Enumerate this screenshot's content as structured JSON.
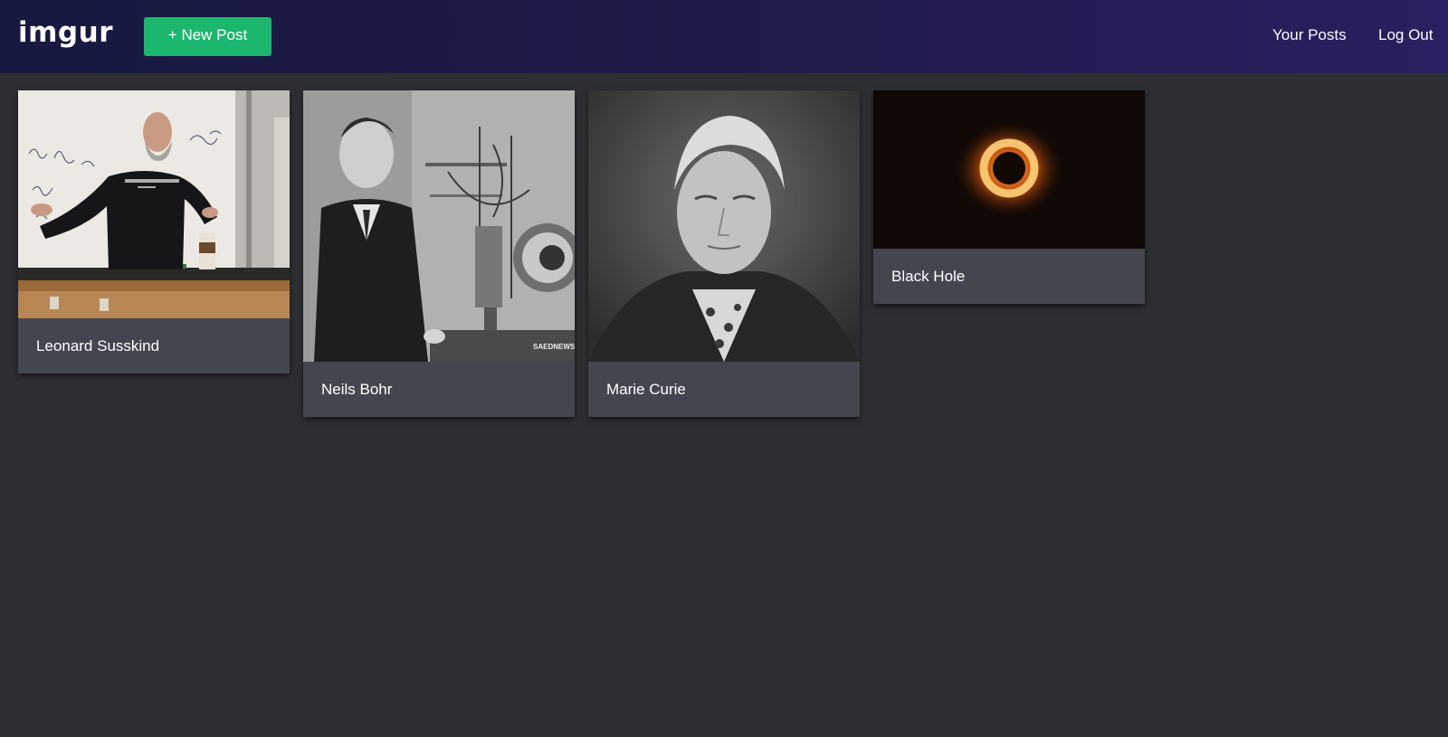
{
  "header": {
    "logo": "imgur",
    "new_post_label": "+ New Post",
    "nav": {
      "your_posts": "Your Posts",
      "log_out": "Log Out"
    }
  },
  "posts": [
    {
      "title": "Leonard Susskind"
    },
    {
      "title": "Neils Bohr",
      "image_watermark": "SAEDNEWS"
    },
    {
      "title": "Marie Curie"
    },
    {
      "title": "Black Hole"
    }
  ],
  "colors": {
    "header_gradient_start": "#171940",
    "header_gradient_end": "#2a1f60",
    "new_post_button": "#1bb76e",
    "page_background": "#2e2f33",
    "card_background": "#44464f"
  }
}
